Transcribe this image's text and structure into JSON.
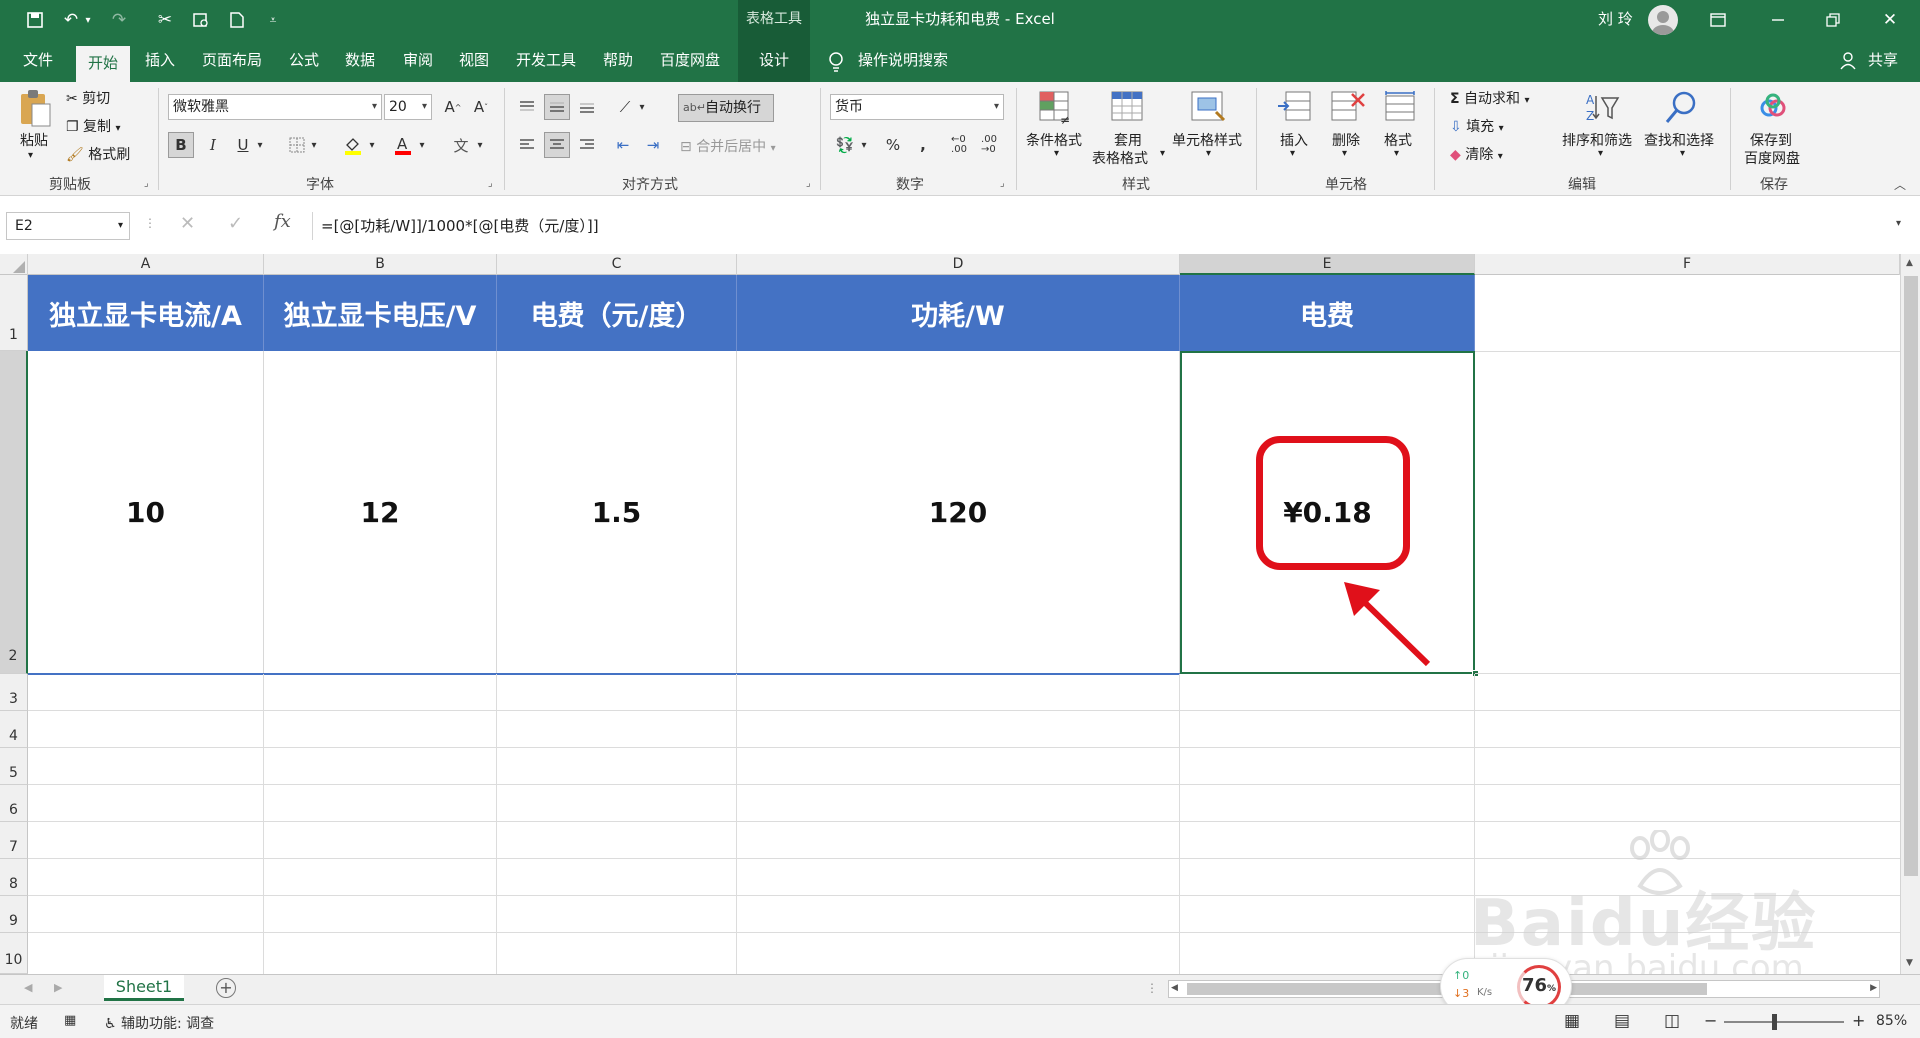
{
  "titlebar": {
    "context_tab": "表格工具",
    "title": "独立显卡功耗和电费  -  Excel",
    "user_name": "刘 玲"
  },
  "tabs": [
    {
      "label": "文件"
    },
    {
      "label": "开始"
    },
    {
      "label": "插入"
    },
    {
      "label": "页面布局"
    },
    {
      "label": "公式"
    },
    {
      "label": "数据"
    },
    {
      "label": "审阅"
    },
    {
      "label": "视图"
    },
    {
      "label": "开发工具"
    },
    {
      "label": "帮助"
    },
    {
      "label": "百度网盘"
    },
    {
      "label": "设计"
    }
  ],
  "tell_me": "操作说明搜索",
  "share_label": "共享",
  "clipboard": {
    "paste": "粘贴",
    "cut": "剪切",
    "copy": "复制",
    "format_painter": "格式刷",
    "group": "剪贴板"
  },
  "font": {
    "name": "微软雅黑",
    "size": "20",
    "group": "字体"
  },
  "alignment": {
    "wrap": "自动换行",
    "merge": "合并后居中",
    "group": "对齐方式"
  },
  "number": {
    "format": "货币",
    "group": "数字"
  },
  "styles": {
    "conditional": "条件格式",
    "table1": "套用",
    "table2": "表格格式",
    "cell_styles": "单元格样式",
    "group": "样式"
  },
  "cells": {
    "insert": "插入",
    "delete": "删除",
    "format": "格式",
    "group": "单元格"
  },
  "editing": {
    "autosum": "自动求和",
    "fill": "填充",
    "clear": "清除",
    "sort": "排序和筛选",
    "find": "查找和选择",
    "group": "编辑"
  },
  "save_group": {
    "btn1": "保存到",
    "btn2": "百度网盘",
    "group": "保存"
  },
  "formula_bar": {
    "name_box": "E2",
    "formula": "=[@[功耗/W]]/1000*[@[电费（元/度）]]"
  },
  "columns": [
    "A",
    "B",
    "C",
    "D",
    "E",
    "F"
  ],
  "rows": [
    "1",
    "2",
    "3",
    "4",
    "5",
    "6",
    "7",
    "8",
    "9",
    "10"
  ],
  "table": {
    "headers": [
      "独立显卡电流/A",
      "独立显卡电压/V",
      "电费（元/度）",
      "功耗/W",
      "电费"
    ],
    "values": [
      "10",
      "12",
      "1.5",
      "120",
      "¥0.18"
    ]
  },
  "sheet_tab": "Sheet1",
  "status": {
    "ready": "就绪",
    "accessibility": "辅助功能: 调查",
    "zoom": "85%",
    "net_up": "0",
    "net_down": "3",
    "net_unit": "K/s",
    "cpu": "76",
    "cpu_unit": "%"
  },
  "watermark": {
    "text": "Baidu经验",
    "url": "jingyan.baidu.com"
  },
  "colors": {
    "excel_green": "#217346",
    "header_blue": "#4472c4",
    "highlight_red": "#e0101a"
  }
}
